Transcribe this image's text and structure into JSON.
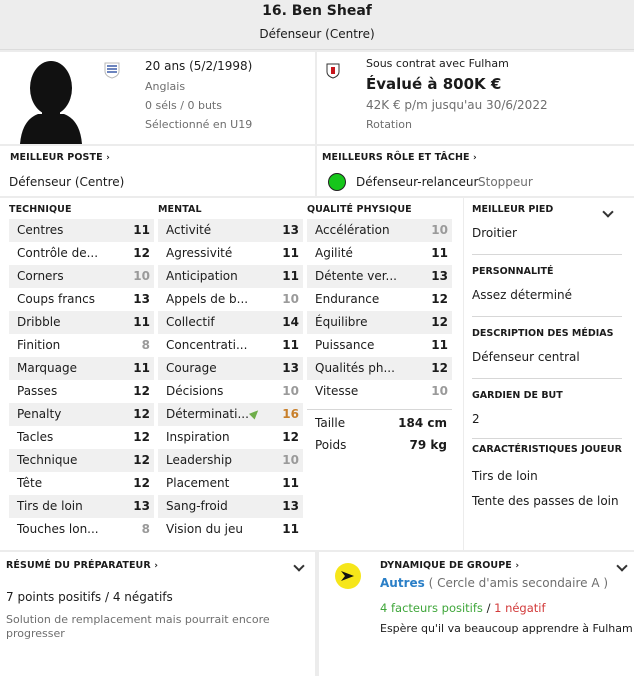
{
  "header": {
    "player_name": "16. Ben Sheaf",
    "position": "Défenseur (Centre)"
  },
  "profile": {
    "age": "20 ans (5/2/1998)",
    "nationality": "Anglais",
    "caps": "0 séls / 0 buts",
    "selection": "Sélectionné en U19"
  },
  "contract": {
    "status": "Sous contrat avec Fulham",
    "value": "Évalué à 800K €",
    "wage": "42K € p/m jusqu'au 30/6/2022",
    "role": "Rotation"
  },
  "best_position": {
    "title": "MEILLEUR POSTE",
    "value": "Défenseur (Centre)"
  },
  "best_role": {
    "title": "MEILLEURS RÔLE ET TÂCHE",
    "role": "Défenseur-relanceur",
    "duty": "Stoppeur",
    "indicator_color": "#16c61b"
  },
  "technique": {
    "title": "TECHNIQUE",
    "rows": [
      {
        "label": "Centres",
        "value": "11"
      },
      {
        "label": "Contrôle de...",
        "value": "12"
      },
      {
        "label": "Corners",
        "value": "10"
      },
      {
        "label": "Coups francs",
        "value": "13"
      },
      {
        "label": "Dribble",
        "value": "11"
      },
      {
        "label": "Finition",
        "value": "8"
      },
      {
        "label": "Marquage",
        "value": "11"
      },
      {
        "label": "Passes",
        "value": "12"
      },
      {
        "label": "Penalty",
        "value": "12"
      },
      {
        "label": "Tacles",
        "value": "12"
      },
      {
        "label": "Technique",
        "value": "12"
      },
      {
        "label": "Tête",
        "value": "12"
      },
      {
        "label": "Tirs de loin",
        "value": "13"
      },
      {
        "label": "Touches lon...",
        "value": "8"
      }
    ]
  },
  "mental": {
    "title": "MENTAL",
    "rows": [
      {
        "label": "Activité",
        "value": "13"
      },
      {
        "label": "Agressivité",
        "value": "11"
      },
      {
        "label": "Anticipation",
        "value": "11"
      },
      {
        "label": "Appels de b...",
        "value": "10"
      },
      {
        "label": "Collectif",
        "value": "14"
      },
      {
        "label": "Concentrati...",
        "value": "11"
      },
      {
        "label": "Courage",
        "value": "13"
      },
      {
        "label": "Décisions",
        "value": "10"
      },
      {
        "label": "Déterminati...",
        "value": "16"
      },
      {
        "label": "Inspiration",
        "value": "12"
      },
      {
        "label": "Leadership",
        "value": "10"
      },
      {
        "label": "Placement",
        "value": "11"
      },
      {
        "label": "Sang-froid",
        "value": "13"
      },
      {
        "label": "Vision du jeu",
        "value": "11"
      }
    ]
  },
  "physical": {
    "title": "QUALITÉ PHYSIQUE",
    "rows": [
      {
        "label": "Accélération",
        "value": "10"
      },
      {
        "label": "Agilité",
        "value": "11"
      },
      {
        "label": "Détente ver...",
        "value": "13"
      },
      {
        "label": "Endurance",
        "value": "12"
      },
      {
        "label": "Équilibre",
        "value": "12"
      },
      {
        "label": "Puissance",
        "value": "11"
      },
      {
        "label": "Qualités ph...",
        "value": "12"
      },
      {
        "label": "Vitesse",
        "value": "10"
      }
    ],
    "height_label": "Taille",
    "height_value": "184 cm",
    "weight_label": "Poids",
    "weight_value": "79 kg"
  },
  "side": {
    "foot_title": "MEILLEUR PIED",
    "foot_value": "Droitier",
    "personality_title": "PERSONNALITÉ",
    "personality_value": "Assez déterminé",
    "media_title": "DESCRIPTION DES MÉDIAS",
    "media_value": "Défenseur central",
    "gk_title": "GARDIEN DE BUT",
    "gk_value": "2",
    "traits_title": "CARACTÉRISTIQUES JOUEUR",
    "traits": [
      "Tirs de loin",
      "Tente des passes de loin"
    ]
  },
  "coach_report": {
    "title": "RÉSUMÉ DU PRÉPARATEUR",
    "points": "7 points positifs / 4 négatifs",
    "summary": "Solution de remplacement mais pourrait encore progresser"
  },
  "group_dynamics": {
    "title": "DYNAMIQUE DE GROUPE",
    "group": "Autres",
    "group_detail": "( Cercle d'amis secondaire A )",
    "positive": "4 facteurs positifs",
    "separator": "/",
    "negative": "1 négatif",
    "note": "Espère qu'il va beaucoup apprendre à Fulham",
    "group_color": "#2a7fc7",
    "positive_color": "#3fa63a",
    "negative_color": "#d23a3a"
  }
}
